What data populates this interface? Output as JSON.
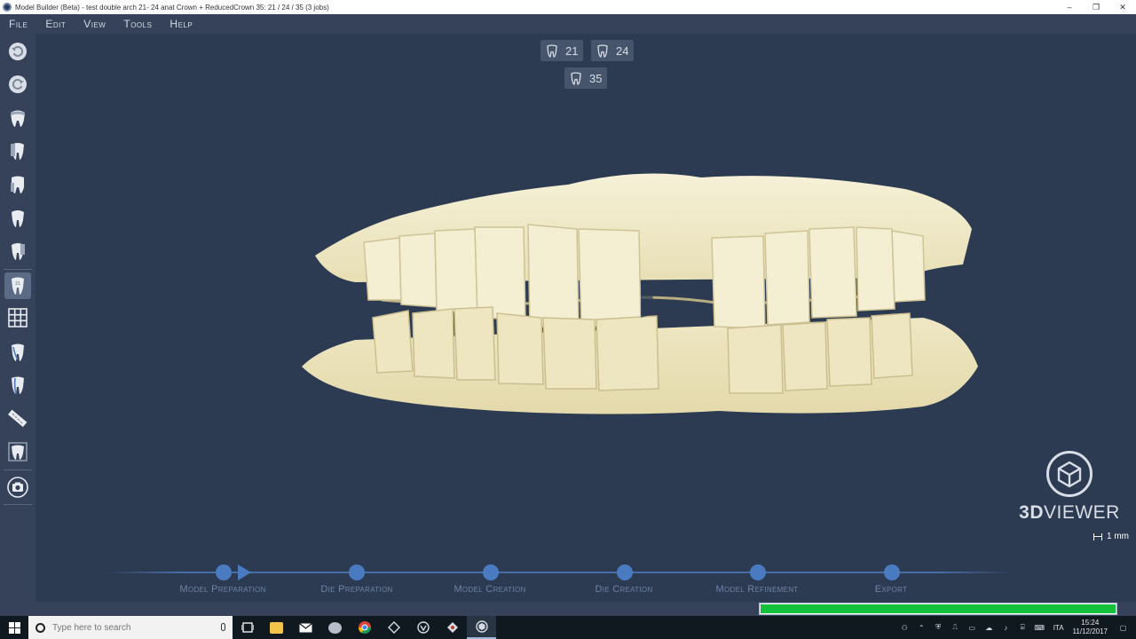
{
  "window": {
    "title": "Model Builder (Beta) - test double arch   21- 24 anat Crown + ReducedCrown 35: 21 / 24 / 35 (3 jobs)",
    "minimize": "–",
    "maximize": "❐",
    "close": "✕"
  },
  "menu": {
    "file": "File",
    "edit": "Edit",
    "view": "View",
    "tools": "Tools",
    "help": "Help"
  },
  "badges": {
    "tooth_a": "21",
    "tooth_b": "24",
    "tooth_c": "35"
  },
  "viewer": {
    "logo_bold": "3D",
    "logo_rest": "VIEWER",
    "scale_label": "1 mm"
  },
  "workflow": {
    "steps": [
      {
        "label": "Model Preparation"
      },
      {
        "label": "Die Preparation"
      },
      {
        "label": "Model Creation"
      },
      {
        "label": "Die Creation"
      },
      {
        "label": "Model Refinement"
      },
      {
        "label": "Export"
      }
    ]
  },
  "progress": {
    "value": 1.0,
    "color": "#13c13a"
  },
  "taskbar": {
    "search_placeholder": "Type here to search",
    "language": "ITA",
    "time": "15:24",
    "date": "11/12/2017"
  },
  "colors": {
    "background": "#2c3a52",
    "panel": "#35425a",
    "accent": "#4a7ac0",
    "model": "#f2ebcc"
  }
}
